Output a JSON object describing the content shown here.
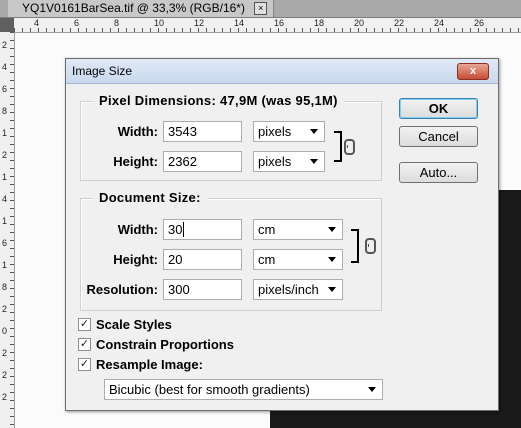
{
  "document": {
    "tab_title": "YQ1V0161BarSea.tif @ 33,3% (RGB/16*)",
    "tab_close": "×",
    "ruler_top_numbers": [
      "4",
      "6",
      "8",
      "10",
      "12",
      "14",
      "16",
      "18",
      "20",
      "22",
      "24",
      "26"
    ],
    "ruler_left_numbers": [
      "2",
      "4",
      "6",
      "8",
      "1",
      "2",
      "1",
      "4",
      "1",
      "6",
      "1",
      "8",
      "2",
      "0",
      "2",
      "2",
      "2"
    ]
  },
  "dialog": {
    "title": "Image Size",
    "close": "x",
    "pixel_dimensions": {
      "legend": "Pixel Dimensions:  47,9M (was 95,1M)",
      "width_label": "Width:",
      "width_value": "3543",
      "width_unit": "pixels",
      "height_label": "Height:",
      "height_value": "2362",
      "height_unit": "pixels"
    },
    "document_size": {
      "legend": "Document Size:",
      "width_label": "Width:",
      "width_value": "30",
      "width_unit": "cm",
      "height_label": "Height:",
      "height_value": "20",
      "height_unit": "cm",
      "resolution_label": "Resolution:",
      "resolution_value": "300",
      "resolution_unit": "pixels/inch"
    },
    "buttons": {
      "ok": "OK",
      "cancel": "Cancel",
      "auto": "Auto..."
    },
    "checkboxes": {
      "scale_styles": "Scale Styles",
      "constrain_proportions": "Constrain Proportions",
      "resample_image": "Resample Image:",
      "check_mark": "✓"
    },
    "resample_method": "Bicubic (best for smooth gradients)"
  }
}
